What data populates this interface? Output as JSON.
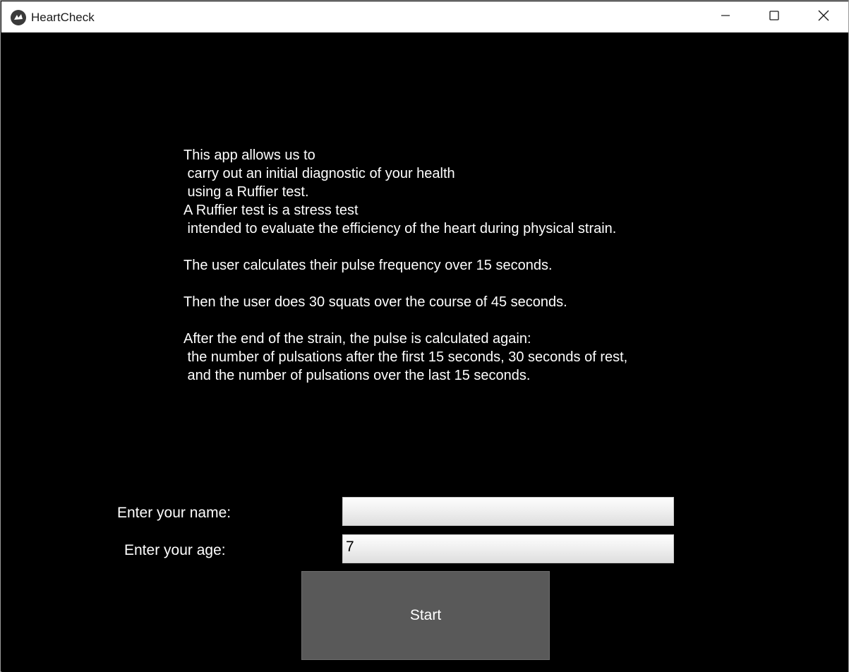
{
  "window": {
    "title": "HeartCheck",
    "icon": "kivy-logo-icon",
    "controls": [
      "minimize-icon",
      "maximize-icon",
      "close-icon"
    ]
  },
  "intro_text": "This app allows us to\n carry out an initial diagnostic of your health\n using a Ruffier test.\nA Ruffier test is a stress test\n intended to evaluate the efficiency of the heart during physical strain.\n\nThe user calculates their pulse frequency over 15 seconds.\n\nThen the user does 30 squats over the course of 45 seconds.\n\nAfter the end of the strain, the pulse is calculated again:\n the number of pulsations after the first 15 seconds, 30 seconds of rest,\n and the number of pulsations over the last 15 seconds.",
  "form": {
    "name_label": "Enter your name:",
    "name_value": "",
    "age_label": "Enter your age:",
    "age_value": "7"
  },
  "start_label": "Start",
  "colors": {
    "background": "#000000",
    "text": "#ffffff",
    "button": "#595959",
    "titlebar": "#ffffff"
  }
}
